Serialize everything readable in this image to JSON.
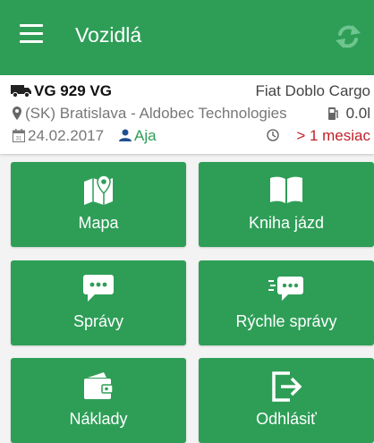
{
  "appbar": {
    "title": "Vozidlá"
  },
  "vehicle": {
    "plate": "VG 929 VG",
    "model": "Fiat Doblo Cargo",
    "address": "(SK) Bratislava - Aldobec Technologies",
    "fuel": "0.0l",
    "date": "24.02.2017",
    "driver": "Aja",
    "last_seen": "> 1 mesiac"
  },
  "tiles": [
    {
      "label": "Mapa",
      "icon": "map-pin-icon"
    },
    {
      "label": "Kniha jázd",
      "icon": "book-icon"
    },
    {
      "label": "Správy",
      "icon": "chat-icon"
    },
    {
      "label": "Rýchle správy",
      "icon": "quick-chat-icon"
    },
    {
      "label": "Náklady",
      "icon": "wallet-icon"
    },
    {
      "label": "Odhlásiť",
      "icon": "logout-icon"
    }
  ],
  "colors": {
    "primary": "#2e9e57",
    "status_red": "#c0202a",
    "sync_icon": "#6fc58f"
  }
}
